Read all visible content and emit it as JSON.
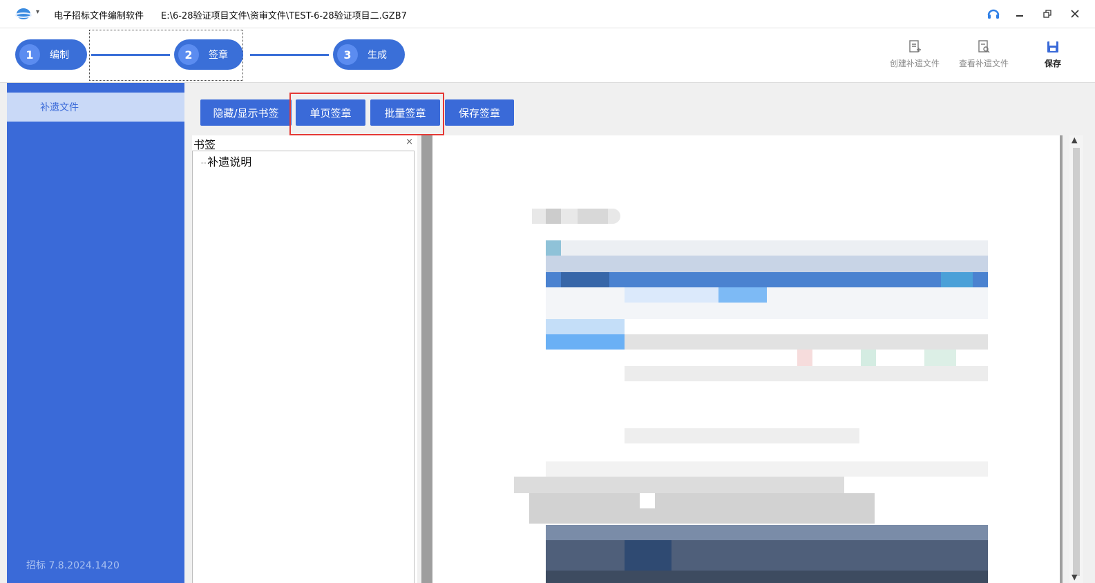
{
  "titlebar": {
    "app_title": "电子招标文件编制软件",
    "file_path": "E:\\6-28验证项目文件\\资审文件\\TEST-6-28验证项目二.GZB7",
    "logo_icon": "app-logo-icon",
    "controls": [
      "headset-icon",
      "minimize-icon",
      "restore-icon",
      "close-icon"
    ]
  },
  "steps": [
    {
      "num": "1",
      "label": "编制"
    },
    {
      "num": "2",
      "label": "签章"
    },
    {
      "num": "3",
      "label": "生成"
    }
  ],
  "toolbar": {
    "create_label": "创建补遗文件",
    "view_label": "查看补遗文件",
    "save_label": "保存"
  },
  "sidebar": {
    "items": [
      {
        "label": "补遗文件"
      }
    ],
    "version": "招标   7.8.2024.1420"
  },
  "actions": {
    "toggle_bookmark": "隐藏/显示书签",
    "single_sign": "单页签章",
    "batch_sign": "批量签章",
    "save_sign": "保存签章"
  },
  "bookmark": {
    "title": "书签",
    "close": "×",
    "items": [
      {
        "label": "补遗说明"
      }
    ]
  },
  "colors": {
    "accent": "#3a6ad8",
    "sidebar_selected": "#c9d9f7",
    "highlight": "#e53935"
  }
}
